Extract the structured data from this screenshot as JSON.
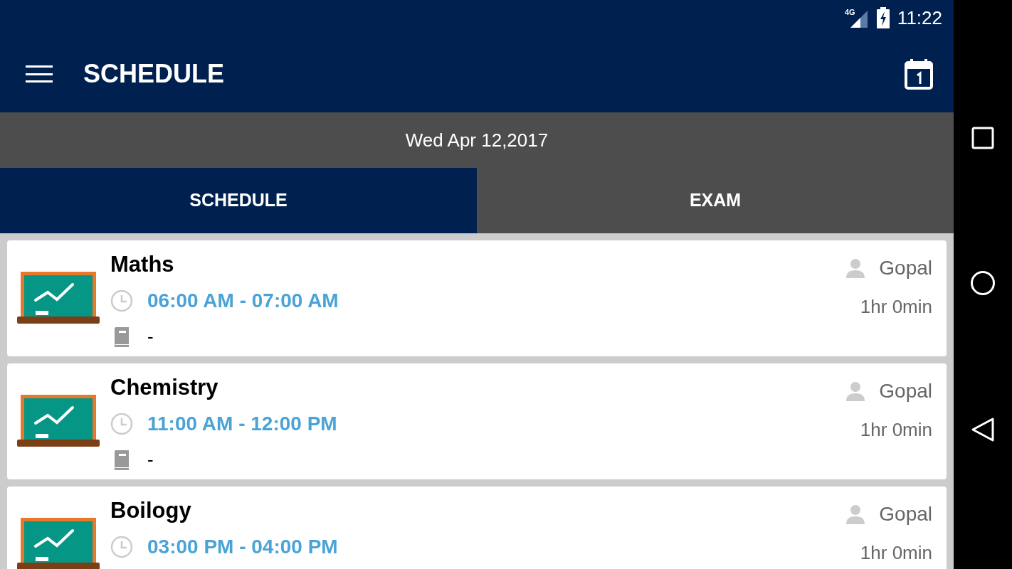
{
  "status_bar": {
    "network": "4G",
    "time": "11:22"
  },
  "toolbar": {
    "title": "SCHEDULE"
  },
  "date_bar": {
    "date": "Wed Apr 12,2017"
  },
  "tabs": [
    {
      "label": "SCHEDULE",
      "selected": true
    },
    {
      "label": "EXAM",
      "selected": false
    }
  ],
  "classes": [
    {
      "subject": "Maths",
      "time": "06:00 AM - 07:00 AM",
      "book": "-",
      "teacher": "Gopal",
      "duration": "1hr 0min"
    },
    {
      "subject": "Chemistry",
      "time": "11:00 AM - 12:00 PM",
      "book": "-",
      "teacher": "Gopal",
      "duration": "1hr 0min"
    },
    {
      "subject": "Boilogy",
      "time": "03:00 PM - 04:00 PM",
      "teacher": "Gopal",
      "duration": "1hr 0min"
    }
  ]
}
